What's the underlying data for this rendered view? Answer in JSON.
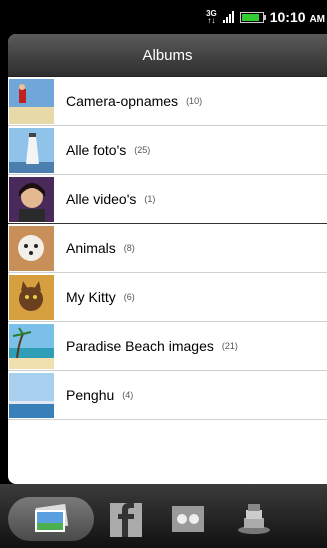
{
  "status": {
    "network": "3G",
    "time": "10:10",
    "ampm": "AM"
  },
  "header": {
    "title": "Albums"
  },
  "albums": [
    {
      "name": "Camera-opnames",
      "count": "(10)",
      "thumb_icon": "camera-photo-thumbnail"
    },
    {
      "name": "Alle foto's",
      "count": "(25)",
      "thumb_icon": "lighthouse-thumbnail"
    },
    {
      "name": "Alle video's",
      "count": "(1)",
      "thumb_icon": "portrait-thumbnail"
    },
    {
      "name": "Animals",
      "count": "(8)",
      "thumb_icon": "dog-thumbnail"
    },
    {
      "name": "My Kitty",
      "count": "(6)",
      "thumb_icon": "cat-thumbnail"
    },
    {
      "name": "Paradise Beach images",
      "count": "(21)",
      "thumb_icon": "beach-thumbnail"
    },
    {
      "name": "Penghu",
      "count": "(4)",
      "thumb_icon": "sky-thumbnail"
    }
  ],
  "bottom_tabs": [
    {
      "icon": "gallery-icon",
      "active": true
    },
    {
      "icon": "facebook-icon",
      "active": false
    },
    {
      "icon": "flickr-icon",
      "active": false
    },
    {
      "icon": "stack-icon",
      "active": false
    }
  ],
  "colors": {
    "battery": "#33cc33",
    "title_bar": "#3a3a3a",
    "background": "#000000"
  }
}
